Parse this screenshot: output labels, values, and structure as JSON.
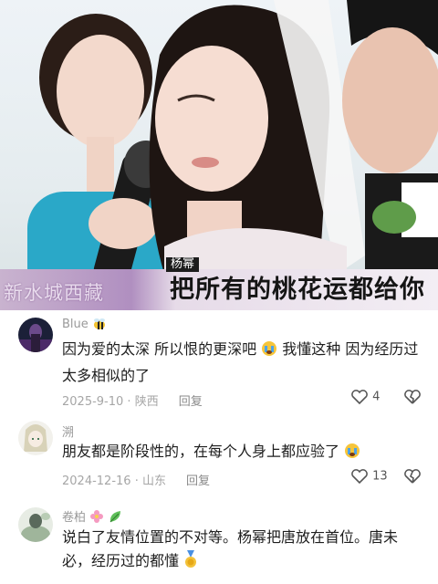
{
  "video": {
    "name_tag": "杨幂",
    "left_caption": "新水城西藏",
    "subtitle": "把所有的桃花运都给你"
  },
  "comments": [
    {
      "user": "Blue",
      "user_emoji": "bee-icon",
      "text_lines": [
        "因为爱的太深 所以恨的更深吧",
        "我懂这种 因为经历过",
        "太多相似的了"
      ],
      "date": "2025-9-10",
      "location": "陕西",
      "reply_label": "回复",
      "likes": "4"
    },
    {
      "user": "溯",
      "text_lines": [
        "朋友都是阶段性的，在每个人身上都应验了"
      ],
      "date": "2024-12-16",
      "location": "山东",
      "reply_label": "回复",
      "likes": "13"
    },
    {
      "user": "卷柏",
      "user_emoji": "flower-icon",
      "text_lines": [
        "说白了友情位置的不对等。杨幂把唐放在首位。唐未",
        "必，经历过的都懂"
      ]
    }
  ],
  "colors": {
    "meta": "#a6a6a6",
    "text": "#1e1e1e",
    "username": "#9a9a9a"
  }
}
